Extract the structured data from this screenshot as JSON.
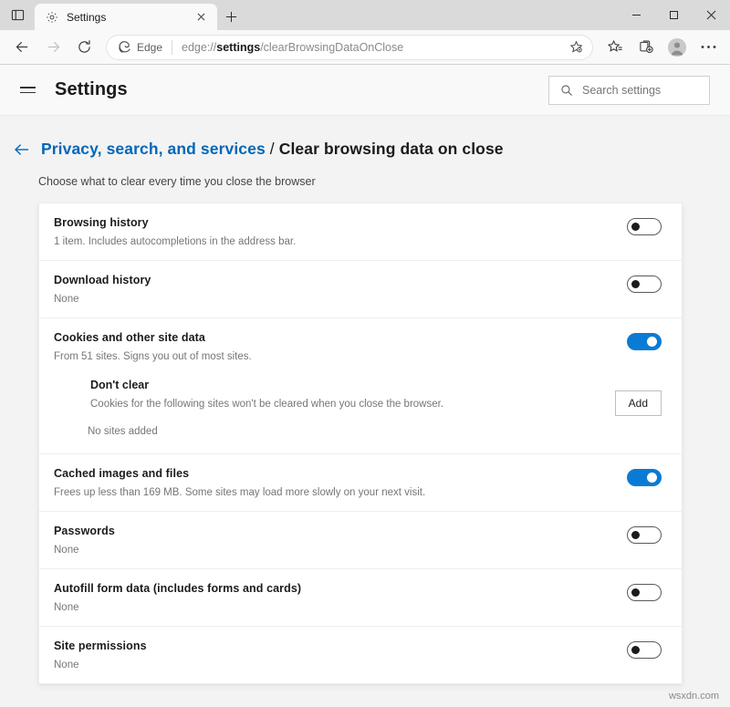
{
  "browser": {
    "tab": {
      "title": "Settings",
      "favicon_icon": "gear-icon",
      "close_icon": "close-icon"
    },
    "new_tab_icon": "plus-icon",
    "tab_search_icon": "tab-search-icon",
    "window_controls": {
      "minimize": "minimize-icon",
      "maximize": "maximize-icon",
      "close": "close-icon"
    },
    "nav": {
      "back_icon": "back-arrow-icon",
      "forward_icon": "forward-arrow-icon",
      "reload_icon": "reload-icon"
    },
    "omnibox": {
      "brand_label": "Edge",
      "brand_icon": "edge-logo-icon",
      "url_prefix": "edge://",
      "url_bold": "settings",
      "url_suffix": "/clearBrowsingDataOnClose",
      "favorite_icon": "add-favorite-icon"
    },
    "toolbar_icons": {
      "favorites": "favorites-star-icon",
      "collections": "collections-icon",
      "profile": "profile-avatar-icon",
      "more": "more-options-icon"
    }
  },
  "settings": {
    "menu_icon": "hamburger-menu-icon",
    "title": "Settings",
    "search": {
      "placeholder": "Search settings",
      "icon": "search-icon"
    }
  },
  "page": {
    "back_icon": "back-arrow-icon",
    "breadcrumb_parent": "Privacy, search, and services",
    "breadcrumb_separator": "/",
    "breadcrumb_current": "Clear browsing data on close",
    "subtitle": "Choose what to clear every time you close the browser"
  },
  "accent_color": "#0a7bd4",
  "link_color": "#0067b8",
  "rows": [
    {
      "title": "Browsing history",
      "desc": "1 item. Includes autocompletions in the address bar.",
      "toggle": "off"
    },
    {
      "title": "Download history",
      "desc": "None",
      "toggle": "off"
    },
    {
      "title": "Cookies and other site data",
      "desc": "From 51 sites. Signs you out of most sites.",
      "toggle": "on",
      "subsection": {
        "title": "Don't clear",
        "desc": "Cookies for the following sites won't be cleared when you close the browser.",
        "empty_text": "No sites added",
        "add_label": "Add"
      }
    },
    {
      "title": "Cached images and files",
      "desc": "Frees up less than 169 MB. Some sites may load more slowly on your next visit.",
      "toggle": "on"
    },
    {
      "title": "Passwords",
      "desc": "None",
      "toggle": "off"
    },
    {
      "title": "Autofill form data (includes forms and cards)",
      "desc": "None",
      "toggle": "off"
    },
    {
      "title": "Site permissions",
      "desc": "None",
      "toggle": "off"
    }
  ],
  "watermark": "wsxdn.com"
}
